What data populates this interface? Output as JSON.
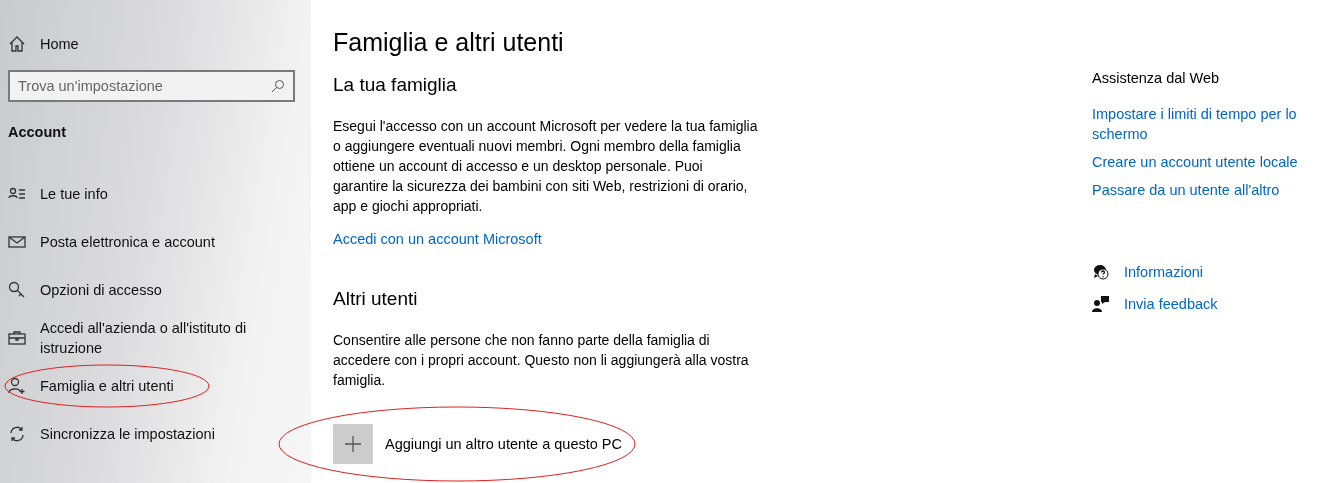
{
  "sidebar": {
    "home": "Home",
    "search": {
      "placeholder": "Trova un'impostazione"
    },
    "section": "Account",
    "items": [
      {
        "kind": "info",
        "label": "Le tue info",
        "circled": false
      },
      {
        "kind": "mail",
        "label": "Posta elettronica e account",
        "circled": false
      },
      {
        "kind": "key",
        "label": "Opzioni di accesso",
        "circled": false
      },
      {
        "kind": "briefcase",
        "label": "Accedi all'azienda o all'istituto di istruzione",
        "circled": false
      },
      {
        "kind": "person",
        "label": "Famiglia e altri utenti",
        "circled": true
      },
      {
        "kind": "sync",
        "label": "Sincronizza le impostazioni",
        "circled": false
      }
    ]
  },
  "main": {
    "title": "Famiglia e altri utenti",
    "family": {
      "heading": "La tua famiglia",
      "text": "Esegui l'accesso con un account Microsoft per vedere la tua famiglia o aggiungere eventuali nuovi membri. Ogni membro della famiglia ottiene un account di accesso e un desktop personale. Puoi garantire la sicurezza dei bambini con siti Web, restrizioni di orario, app e giochi appropriati.",
      "link": "Accedi con un account Microsoft"
    },
    "others": {
      "heading": "Altri utenti",
      "text": "Consentire alle persone che non fanno parte della famiglia di accedere con i propri account. Questo non li aggiungerà alla vostra famiglia.",
      "add_button": {
        "label": "Aggiungi un altro utente a questo PC",
        "circled": true
      }
    }
  },
  "aside": {
    "heading": "Assistenza dal Web",
    "links": [
      "Impostare i limiti di tempo per lo schermo",
      "Creare un account utente locale",
      "Passare da un utente all'altro"
    ],
    "actions": [
      {
        "kind": "help",
        "label": "Informazioni"
      },
      {
        "kind": "feedback",
        "label": "Invia feedback"
      }
    ]
  }
}
